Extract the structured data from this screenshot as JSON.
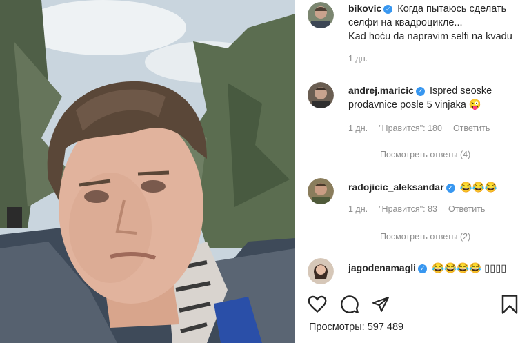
{
  "post": {
    "author": "bikovic",
    "caption_line1": "Когда пытаюсь сделать",
    "caption_line2": "селфи на квадроцикле...",
    "caption_line3": "Kad hoću da napravim selfi na kvadu",
    "time": "1 дн."
  },
  "comments": [
    {
      "username": "andrej.maricic",
      "text_line1": "Ispred seoske",
      "text_line2": "prodavnice posle 5 vinjaka 😜",
      "time": "1 дн.",
      "likes": "\"Нравится\": 180",
      "reply": "Ответить",
      "view_replies": "Посмотреть ответы (4)"
    },
    {
      "username": "radojicic_aleksandar",
      "text": "😂😂😂",
      "time": "1 дн.",
      "likes": "\"Нравится\": 83",
      "reply": "Ответить",
      "view_replies": "Посмотреть ответы (2)"
    },
    {
      "username": "jagodenamagli",
      "text": "😂😂😂😂 ▯▯▯▯"
    }
  ],
  "footer": {
    "views": "Просмотры: 597 489"
  },
  "icons": [
    "heart-icon",
    "comment-icon",
    "share-icon",
    "bookmark-icon",
    "verified-icon"
  ],
  "colors": {
    "verified": "#3897f0",
    "meta_text": "#8e8e8e",
    "text": "#262626"
  }
}
